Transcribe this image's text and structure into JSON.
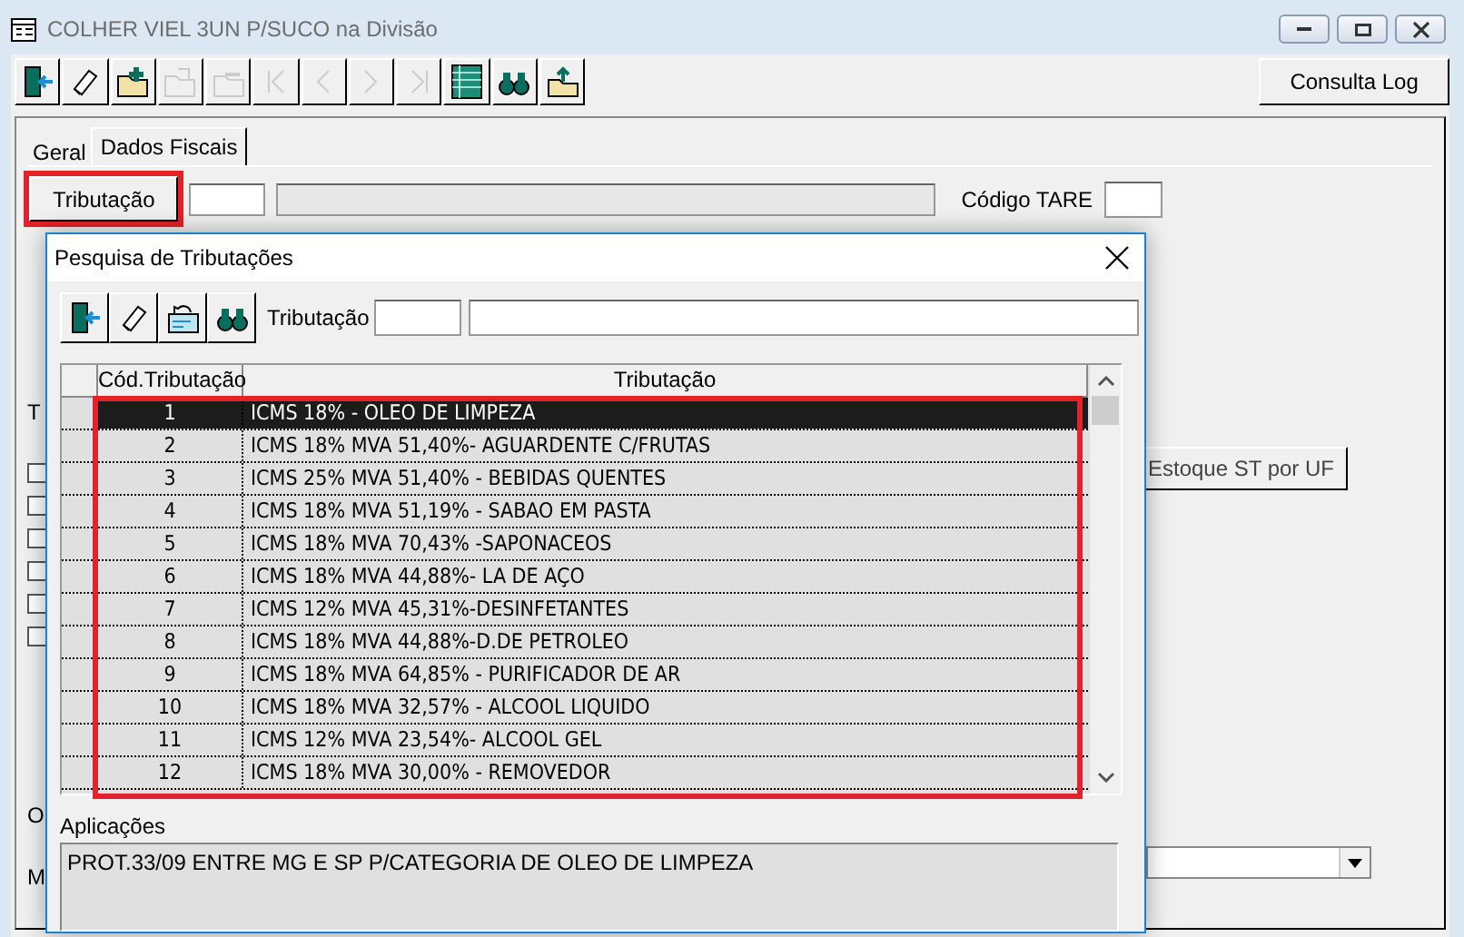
{
  "window": {
    "title": "COLHER VIEL 3UN P/SUCO na Divisão"
  },
  "toolbar": [
    {
      "kind": "exit",
      "disabled": false
    },
    {
      "kind": "eraser",
      "disabled": false
    },
    {
      "kind": "add",
      "disabled": false
    },
    {
      "kind": "edit",
      "disabled": true
    },
    {
      "kind": "remove",
      "disabled": true
    },
    {
      "kind": "first",
      "disabled": true
    },
    {
      "kind": "prev",
      "disabled": true
    },
    {
      "kind": "next",
      "disabled": true
    },
    {
      "kind": "last",
      "disabled": true
    },
    {
      "kind": "grid",
      "disabled": false
    },
    {
      "kind": "search",
      "disabled": false
    },
    {
      "kind": "export",
      "disabled": false
    }
  ],
  "log_button": "Consulta Log",
  "tabs": [
    {
      "label": "Geral",
      "selected": false
    },
    {
      "label": "Dados Fiscais",
      "selected": true
    }
  ],
  "tributacao_button": {
    "label": "Tributação",
    "highlighted": true
  },
  "codigo_tare_label": "Código TARE",
  "estoque_button": "Estoque ST por UF",
  "label_fragments": [
    "T",
    "O",
    "M"
  ],
  "checkboxes": [
    {
      "checked": false
    },
    {
      "checked": false
    },
    {
      "checked": false
    },
    {
      "checked": false
    },
    {
      "checked": false
    },
    {
      "checked": false
    }
  ],
  "dialog": {
    "title": "Pesquisa de Tributações",
    "toolbar": [
      {
        "kind": "exit"
      },
      {
        "kind": "eraser"
      },
      {
        "kind": "undo"
      },
      {
        "kind": "search"
      }
    ],
    "filter_label": "Tributação",
    "grid": {
      "highlighted": true,
      "columns": [
        "Cód.Tributação",
        "Tributação"
      ],
      "rows": [
        {
          "code": "1",
          "name": "ICMS 18% - OLEO DE LIMPEZA",
          "selected": true
        },
        {
          "code": "2",
          "name": "ICMS 18% MVA 51,40%- AGUARDENTE C/FRUTAS",
          "selected": false
        },
        {
          "code": "3",
          "name": "ICMS 25% MVA 51,40% - BEBIDAS QUENTES",
          "selected": false
        },
        {
          "code": "4",
          "name": "ICMS 18% MVA 51,19% - SABAO EM PASTA",
          "selected": false
        },
        {
          "code": "5",
          "name": "ICMS 18% MVA 70,43% -SAPONACEOS",
          "selected": false
        },
        {
          "code": "6",
          "name": "ICMS 18% MVA 44,88%- LA DE AÇO",
          "selected": false
        },
        {
          "code": "7",
          "name": "ICMS 12% MVA 45,31%-DESINFETANTES",
          "selected": false
        },
        {
          "code": "8",
          "name": "ICMS 18% MVA 44,88%-D.DE PETROLEO",
          "selected": false
        },
        {
          "code": "9",
          "name": "ICMS 18% MVA 64,85% - PURIFICADOR DE AR",
          "selected": false
        },
        {
          "code": "10",
          "name": "ICMS 18% MVA 32,57% - ALCOOL LIQUIDO",
          "selected": false
        },
        {
          "code": "11",
          "name": "ICMS 12% MVA 23,54%- ALCOOL GEL",
          "selected": false
        },
        {
          "code": "12",
          "name": "ICMS 18% MVA 30,00% - REMOVEDOR",
          "selected": false
        }
      ]
    },
    "aplicacoes_label": "Aplicações",
    "aplicacoes_value": "PROT.33/09 ENTRE MG E SP P/CATEGORIA DE OLEO DE LIMPEZA"
  }
}
